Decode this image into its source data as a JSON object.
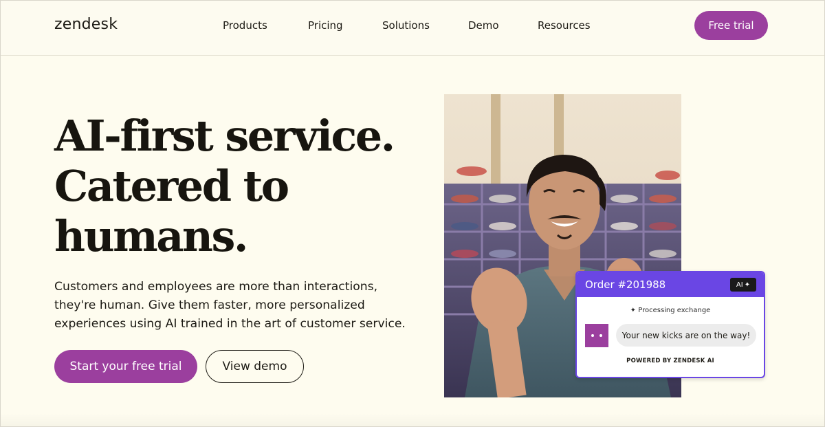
{
  "header": {
    "logo": "zendesk",
    "nav": [
      {
        "label": "Products"
      },
      {
        "label": "Pricing"
      },
      {
        "label": "Solutions"
      },
      {
        "label": "Demo"
      },
      {
        "label": "Resources"
      }
    ],
    "cta_label": "Free trial"
  },
  "hero": {
    "headline": [
      "AI-first service.",
      "Catered to",
      "humans."
    ],
    "subtext": "Customers and employees are more than interactions, they're human. Give them faster, more personalized experiences using AI trained in the art of customer service.",
    "primary_cta": "Start your free trial",
    "secondary_cta": "View demo"
  },
  "chat_card": {
    "order": "Order #201988",
    "ai_badge": "AI",
    "processing": "Processing exchange",
    "message": "Your new kicks are on the way!",
    "powered_by": "POWERED BY ZENDESK AI"
  },
  "colors": {
    "background": "#fefcef",
    "brand_purple": "#9b3f9e",
    "chat_accent": "#6a46e4",
    "text": "#1c1a14"
  }
}
